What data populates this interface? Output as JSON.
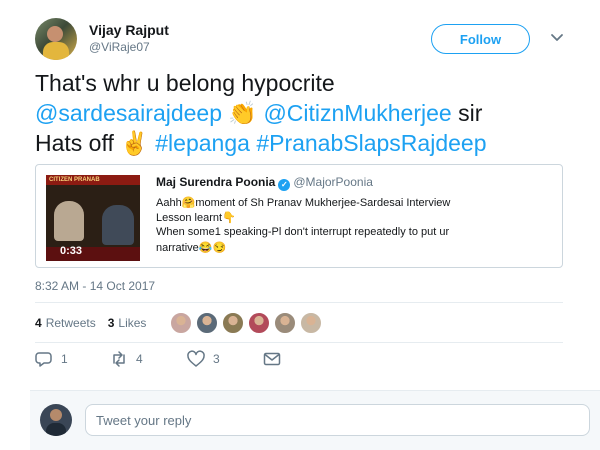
{
  "author": {
    "name": "Vijay Rajput",
    "handle": "@ViRaje07",
    "follow_label": "Follow"
  },
  "tweet": {
    "line1": "That's whr u belong hypocrite",
    "mention1": "@sardesairajdeep",
    "clap_emoji": "👏",
    "mention2": "@CitiznMukherjee",
    "sir_word": "sir",
    "hats_off": "Hats off",
    "victory_emoji": "✌",
    "hashtag1": "#lepanga",
    "hashtag2": "#PranabSlapsRajdeep"
  },
  "quoted_tweet": {
    "name": "Maj Surendra Poonia",
    "handle": "@MajorPoonia",
    "video_duration": "0:33",
    "thumbnail_banner": "CITIZEN PRANAB",
    "line1": "Aahh🤗moment of Sh Pranav Mukherjee-Sardesai Interview",
    "line2": "Lesson learnt👇",
    "line3": "When some1 speaking-Pl don't interrupt repeatedly to put ur",
    "line4": "narrative😂😏"
  },
  "timestamp": "8:32 AM - 14 Oct 2017",
  "stats": {
    "retweets_count": "4",
    "retweets_label": "Retweets",
    "likes_count": "3",
    "likes_label": "Likes"
  },
  "likers": [
    {
      "name": "liker-1",
      "color": "#c9a6a0"
    },
    {
      "name": "liker-2",
      "color": "#5b6a78"
    },
    {
      "name": "liker-3",
      "color": "#8a7a54"
    },
    {
      "name": "liker-4",
      "color": "#b24a5a"
    },
    {
      "name": "liker-5",
      "color": "#9a8b7a"
    },
    {
      "name": "liker-6",
      "color": "#c8b8a4"
    }
  ],
  "actions": {
    "reply_count": "1",
    "retweet_count": "4",
    "like_count": "3"
  },
  "reply": {
    "placeholder": "Tweet your reply"
  },
  "colors": {
    "accent": "#1da1f2",
    "secondary_text": "#657786",
    "primary_text": "#14171a",
    "border": "#e6ecf0"
  }
}
